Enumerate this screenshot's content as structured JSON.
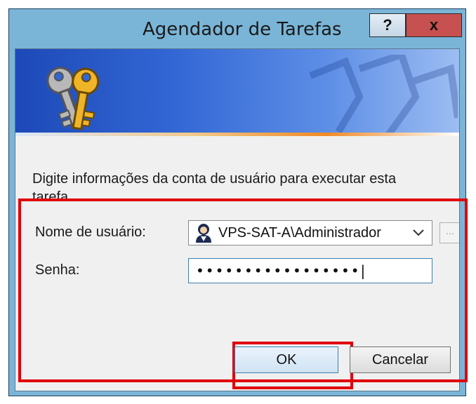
{
  "window": {
    "title": "Agendador de Tarefas",
    "help_label": "?",
    "close_label": "x"
  },
  "instruction": "Digite informações da conta de usuário para executar esta tarefa.",
  "form": {
    "username_label": "Nome de usuário:",
    "username_value": "VPS-SAT-A\\Administrador",
    "browse_label": "...",
    "password_label": "Senha:",
    "password_value": "•••••••••••••••••|"
  },
  "buttons": {
    "ok_label": "OK",
    "cancel_label": "Cancelar"
  },
  "colors": {
    "highlight": "#e0000b",
    "banner": "#2f62d0",
    "close_button": "#c75050"
  }
}
